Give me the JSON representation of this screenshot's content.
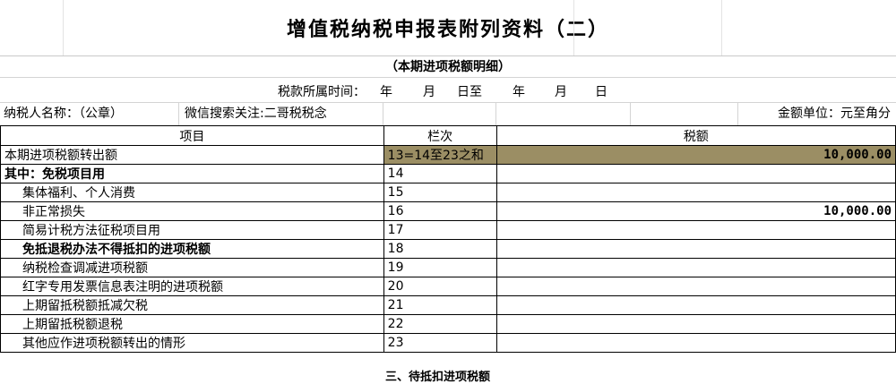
{
  "title": "增值税纳税申报表附列资料（二）",
  "subtitle": "（本期进项税额明细）",
  "period": {
    "label": "税款所属时间：",
    "year1": "年",
    "month1": "月",
    "day_to": "日至",
    "year2": "年",
    "month2": "月",
    "day2": "日"
  },
  "info": {
    "taxpayer_label": "纳税人名称：（公章）",
    "wechat": "微信搜索关注:二哥税税念",
    "unit": "金额单位：元至角分"
  },
  "table": {
    "headers": [
      "项目",
      "栏次",
      "税额"
    ],
    "rows": [
      {
        "item": "本期进项税额转出额",
        "no": "13=14至23之和",
        "amount": "10,000.00",
        "bold": false,
        "indent": false,
        "highlight": true
      },
      {
        "item": "其中：免税项目用",
        "no": "14",
        "amount": "",
        "bold": true,
        "indent": false,
        "highlight": false
      },
      {
        "item": "集体福利、个人消费",
        "no": "15",
        "amount": "",
        "bold": false,
        "indent": true,
        "highlight": false
      },
      {
        "item": "非正常损失",
        "no": "16",
        "amount": "10,000.00",
        "bold": false,
        "indent": true,
        "highlight": false
      },
      {
        "item": "简易计税方法征税项目用",
        "no": "17",
        "amount": "",
        "bold": false,
        "indent": true,
        "highlight": false
      },
      {
        "item": "免抵退税办法不得抵扣的进项税额",
        "no": "18",
        "amount": "",
        "bold": true,
        "indent": true,
        "highlight": false
      },
      {
        "item": "纳税检查调减进项税额",
        "no": "19",
        "amount": "",
        "bold": false,
        "indent": true,
        "highlight": false
      },
      {
        "item": "红字专用发票信息表注明的进项税额",
        "no": "20",
        "amount": "",
        "bold": false,
        "indent": true,
        "highlight": false
      },
      {
        "item": "上期留抵税额抵减欠税",
        "no": "21",
        "amount": "",
        "bold": false,
        "indent": true,
        "highlight": false
      },
      {
        "item": "上期留抵税额退税",
        "no": "22",
        "amount": "",
        "bold": false,
        "indent": true,
        "highlight": false
      },
      {
        "item": "其他应作进项税额转出的情形",
        "no": "23",
        "amount": "",
        "bold": false,
        "indent": true,
        "highlight": false
      }
    ],
    "next_section": "三、待抵扣进项税额"
  },
  "colors": {
    "highlight": "#9b8e64"
  }
}
